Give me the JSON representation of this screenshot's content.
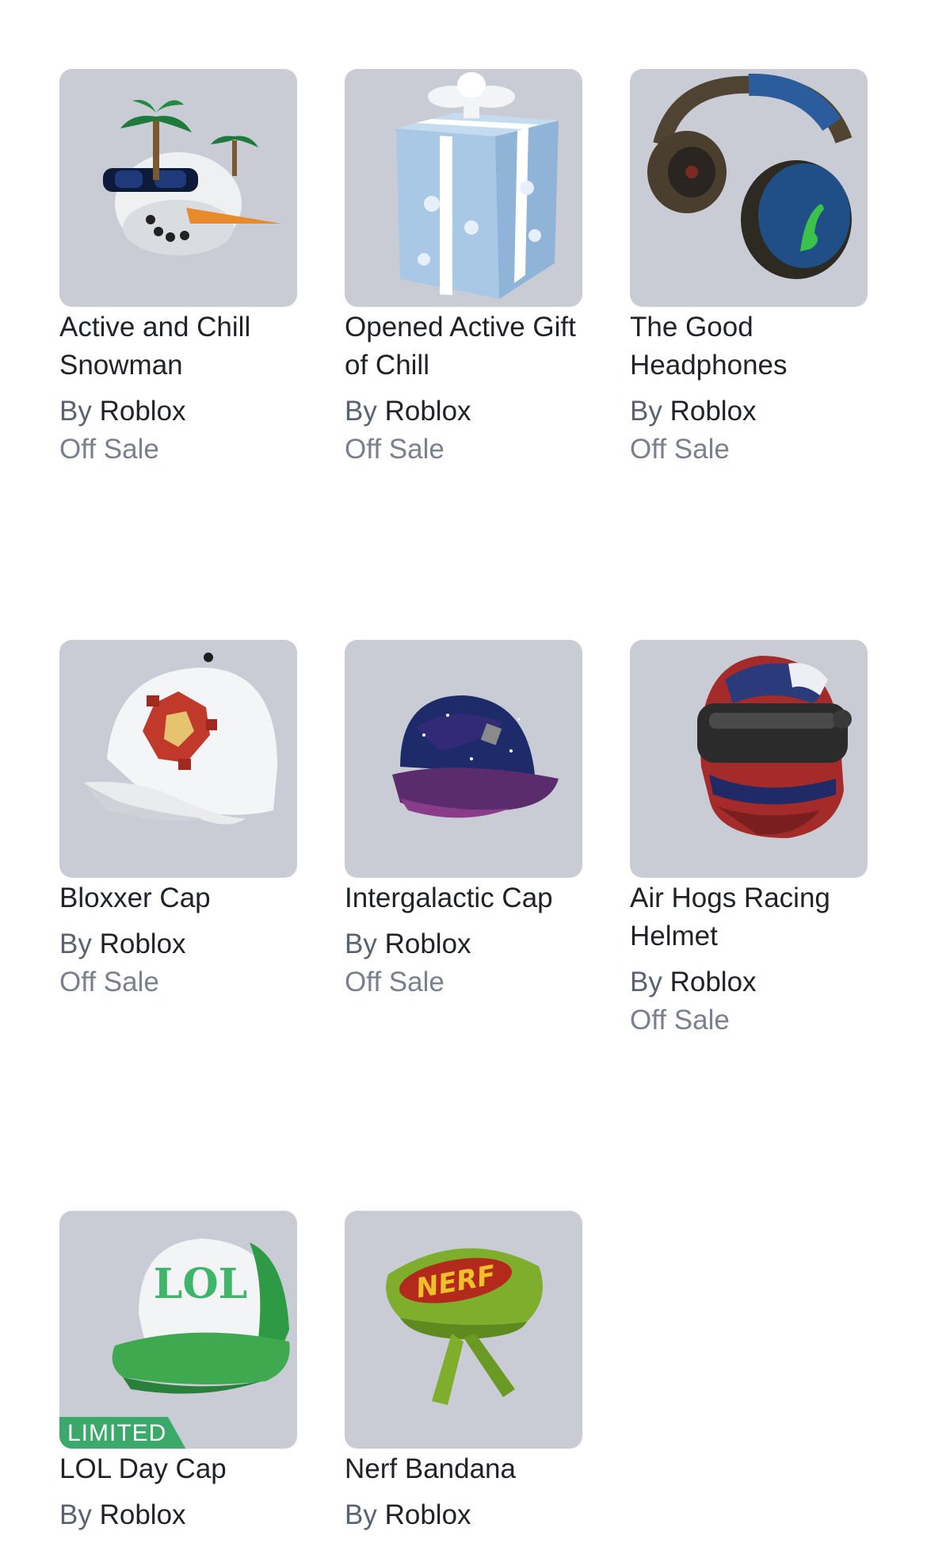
{
  "items": [
    {
      "name": "Active and Chill Snowman",
      "by": "By",
      "creator": "Roblox",
      "status": "Off Sale",
      "icon": "snowman-hat-icon"
    },
    {
      "name": "Opened Active Gift of Chill",
      "by": "By",
      "creator": "Roblox",
      "status": "Off Sale",
      "icon": "gift-box-icon"
    },
    {
      "name": "The Good Headphones",
      "by": "By",
      "creator": "Roblox",
      "status": "Off Sale",
      "icon": "headphones-icon"
    },
    {
      "name": "Bloxxer Cap",
      "by": "By",
      "creator": "Roblox",
      "status": "Off Sale",
      "icon": "white-cap-icon"
    },
    {
      "name": "Intergalactic Cap",
      "by": "By",
      "creator": "Roblox",
      "status": "Off Sale",
      "icon": "galaxy-cap-icon"
    },
    {
      "name": "Air Hogs Racing Helmet",
      "by": "By",
      "creator": "Roblox",
      "status": "Off Sale",
      "icon": "racing-helmet-icon"
    },
    {
      "name": "LOL Day Cap",
      "by": "By",
      "creator": "Roblox",
      "status": "",
      "badge": "LIMITED",
      "cap_text": "LOL",
      "icon": "lol-cap-icon"
    },
    {
      "name": "Nerf Bandana",
      "by": "By",
      "creator": "Roblox",
      "status": "",
      "bandana_text": "NERF",
      "icon": "bandana-icon"
    }
  ],
  "colors": {
    "thumb_bg": "#c9ccd4",
    "limited_badge": "#3aa96a",
    "status_text": "#7a808c"
  }
}
